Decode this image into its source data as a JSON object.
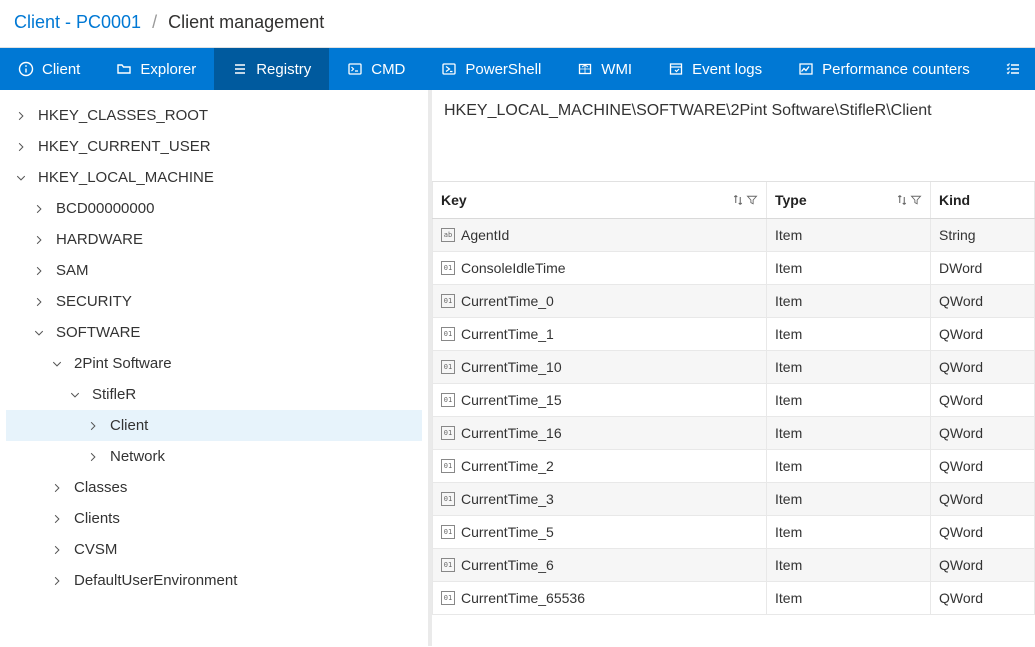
{
  "breadcrumb": {
    "client_label": "Client - PC0001",
    "page_label": "Client management"
  },
  "toolbar": {
    "tabs": [
      {
        "id": "client",
        "label": "Client",
        "icon": "info"
      },
      {
        "id": "explorer",
        "label": "Explorer",
        "icon": "folder"
      },
      {
        "id": "registry",
        "label": "Registry",
        "icon": "list",
        "active": true
      },
      {
        "id": "cmd",
        "label": "CMD",
        "icon": "terminal"
      },
      {
        "id": "powershell",
        "label": "PowerShell",
        "icon": "ps"
      },
      {
        "id": "wmi",
        "label": "WMI",
        "icon": "box"
      },
      {
        "id": "eventlogs",
        "label": "Event logs",
        "icon": "event"
      },
      {
        "id": "perf",
        "label": "Performance counters",
        "icon": "perf"
      }
    ]
  },
  "tree": {
    "items": [
      {
        "label": "HKEY_CLASSES_ROOT",
        "indent": 0,
        "expanded": false
      },
      {
        "label": "HKEY_CURRENT_USER",
        "indent": 0,
        "expanded": false
      },
      {
        "label": "HKEY_LOCAL_MACHINE",
        "indent": 0,
        "expanded": true
      },
      {
        "label": "BCD00000000",
        "indent": 1,
        "expanded": false
      },
      {
        "label": "HARDWARE",
        "indent": 1,
        "expanded": false
      },
      {
        "label": "SAM",
        "indent": 1,
        "expanded": false
      },
      {
        "label": "SECURITY",
        "indent": 1,
        "expanded": false
      },
      {
        "label": "SOFTWARE",
        "indent": 1,
        "expanded": true
      },
      {
        "label": "2Pint Software",
        "indent": 2,
        "expanded": true
      },
      {
        "label": "StifleR",
        "indent": 3,
        "expanded": true
      },
      {
        "label": "Client",
        "indent": 4,
        "expanded": false,
        "selected": true
      },
      {
        "label": "Network",
        "indent": 4,
        "expanded": false
      },
      {
        "label": "Classes",
        "indent": 2,
        "expanded": false
      },
      {
        "label": "Clients",
        "indent": 2,
        "expanded": false
      },
      {
        "label": "CVSM",
        "indent": 2,
        "expanded": false
      },
      {
        "label": "DefaultUserEnvironment",
        "indent": 2,
        "expanded": false
      }
    ]
  },
  "pathbar": {
    "path": "HKEY_LOCAL_MACHINE\\SOFTWARE\\2Pint Software\\StifleR\\Client"
  },
  "grid": {
    "columns": {
      "key": "Key",
      "type": "Type",
      "kind": "Kind"
    },
    "rows": [
      {
        "key": "AgentId",
        "type": "Item",
        "kind": "String",
        "icon": "str"
      },
      {
        "key": "ConsoleIdleTime",
        "type": "Item",
        "kind": "DWord",
        "icon": "bin"
      },
      {
        "key": "CurrentTime_0",
        "type": "Item",
        "kind": "QWord",
        "icon": "bin"
      },
      {
        "key": "CurrentTime_1",
        "type": "Item",
        "kind": "QWord",
        "icon": "bin"
      },
      {
        "key": "CurrentTime_10",
        "type": "Item",
        "kind": "QWord",
        "icon": "bin"
      },
      {
        "key": "CurrentTime_15",
        "type": "Item",
        "kind": "QWord",
        "icon": "bin"
      },
      {
        "key": "CurrentTime_16",
        "type": "Item",
        "kind": "QWord",
        "icon": "bin"
      },
      {
        "key": "CurrentTime_2",
        "type": "Item",
        "kind": "QWord",
        "icon": "bin"
      },
      {
        "key": "CurrentTime_3",
        "type": "Item",
        "kind": "QWord",
        "icon": "bin"
      },
      {
        "key": "CurrentTime_5",
        "type": "Item",
        "kind": "QWord",
        "icon": "bin"
      },
      {
        "key": "CurrentTime_6",
        "type": "Item",
        "kind": "QWord",
        "icon": "bin"
      },
      {
        "key": "CurrentTime_65536",
        "type": "Item",
        "kind": "QWord",
        "icon": "bin"
      }
    ]
  }
}
